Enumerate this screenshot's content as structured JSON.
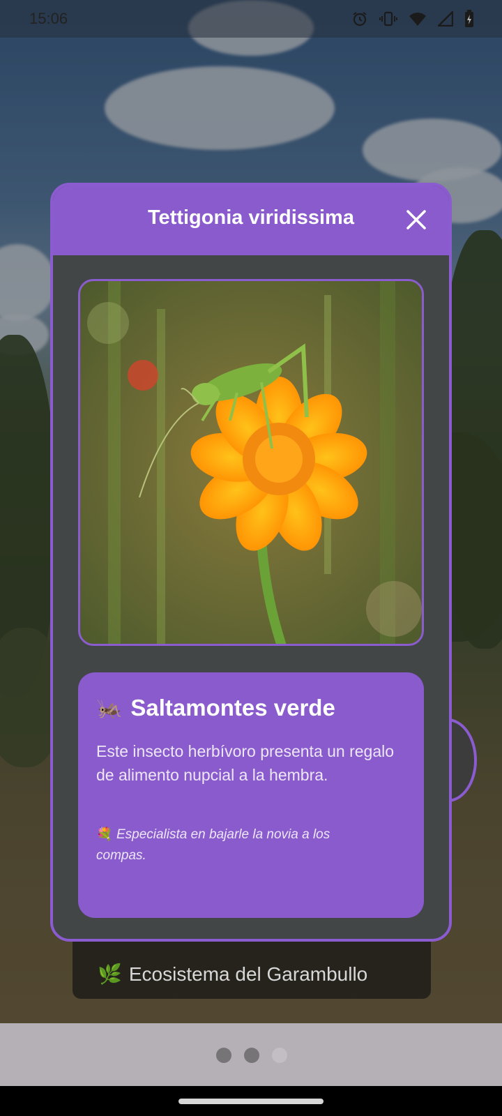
{
  "status_bar": {
    "time": "15:06",
    "icons": [
      "alarm-icon",
      "vibrate-icon",
      "wifi-icon",
      "signal-icon",
      "battery-icon"
    ]
  },
  "dialog": {
    "title": "Tettigonia viridissima",
    "close_icon": "close-icon",
    "image_alt": "Saltamontes verde sobre flor naranja",
    "card": {
      "emoji": "🦗",
      "title": "Saltamontes verde",
      "description": "Este insecto herbívoro presenta un regalo de alimento nupcial a la hembra.",
      "note_emoji": "💐",
      "note": "Especialista en bajarle la novia a los compas."
    }
  },
  "banner": {
    "emoji": "🌿",
    "text": "Ecosistema del Garambullo"
  },
  "page_indicator": {
    "count": 3,
    "active_index": 0
  },
  "colors": {
    "accent_purple": "#8a5bcd",
    "dialog_body": "#424646",
    "banner_bg": "#161616",
    "indicator_bg": "#b5b0b6"
  }
}
